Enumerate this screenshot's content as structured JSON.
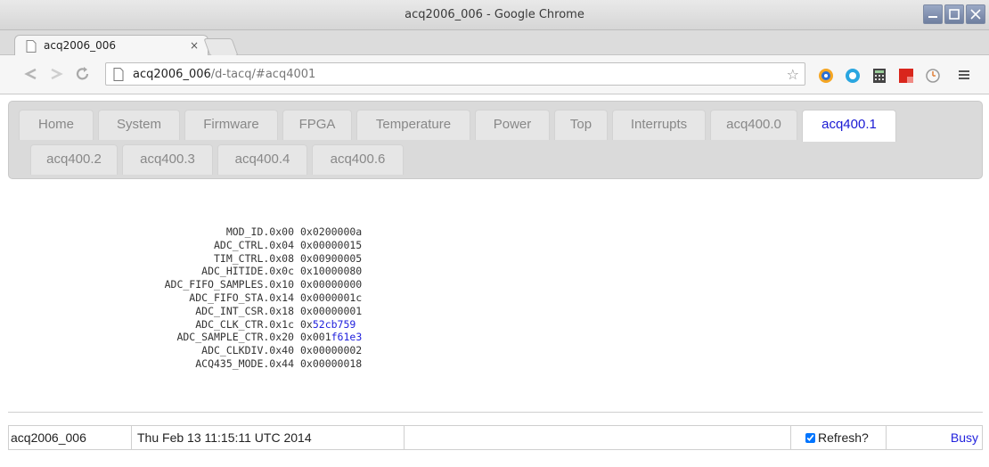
{
  "window": {
    "title": "acq2006_006 - Google Chrome"
  },
  "browser": {
    "tab_title": "acq2006_006",
    "tab_close": "×",
    "url_host": "acq2006_006",
    "url_path": "/d-tacq/#acq4001"
  },
  "nav_tabs": [
    {
      "label": "Home"
    },
    {
      "label": "System"
    },
    {
      "label": "Firmware"
    },
    {
      "label": "FPGA"
    },
    {
      "label": "Temperature"
    },
    {
      "label": "Power"
    },
    {
      "label": "Top"
    },
    {
      "label": "Interrupts"
    },
    {
      "label": "acq400.0"
    },
    {
      "label": "acq400.1",
      "active": true
    },
    {
      "label": "acq400.2"
    },
    {
      "label": "acq400.3"
    },
    {
      "label": "acq400.4"
    },
    {
      "label": "acq400.6"
    }
  ],
  "registers": [
    {
      "name": "MOD_ID.0x00",
      "value": "0x0200000a",
      "hl": ""
    },
    {
      "name": "ADC_CTRL.0x04",
      "value": "0x00000015",
      "hl": ""
    },
    {
      "name": "TIM_CTRL.0x08",
      "value": "0x00900005",
      "hl": ""
    },
    {
      "name": "ADC_HITIDE.0x0c",
      "value": "0x10000080",
      "hl": ""
    },
    {
      "name": "ADC_FIFO_SAMPLES.0x10",
      "value": "0x00000000",
      "hl": ""
    },
    {
      "name": "ADC_FIFO_STA.0x14",
      "value": "0x0000001c",
      "hl": ""
    },
    {
      "name": "ADC_INT_CSR.0x18",
      "value": "0x00000001",
      "hl": ""
    },
    {
      "name": "ADC_CLK_CTR.0x1c",
      "value": "0x",
      "hl": "52cb759"
    },
    {
      "name": "ADC_SAMPLE_CTR.0x20",
      "value": "0x001",
      "hl": "f61e3"
    },
    {
      "name": "ADC_CLKDIV.0x40",
      "value": "0x00000002",
      "hl": ""
    },
    {
      "name": "ACQ435_MODE.0x44",
      "value": "0x00000018",
      "hl": ""
    }
  ],
  "status": {
    "host": "acq2006_006",
    "datetime": "Thu Feb 13 11:15:11 UTC 2014",
    "refresh_label": "Refresh?",
    "refresh_checked": true,
    "busy": "Busy"
  },
  "colors": {
    "accent": "#1a1ad4",
    "highlight_value": "#2222dd"
  }
}
